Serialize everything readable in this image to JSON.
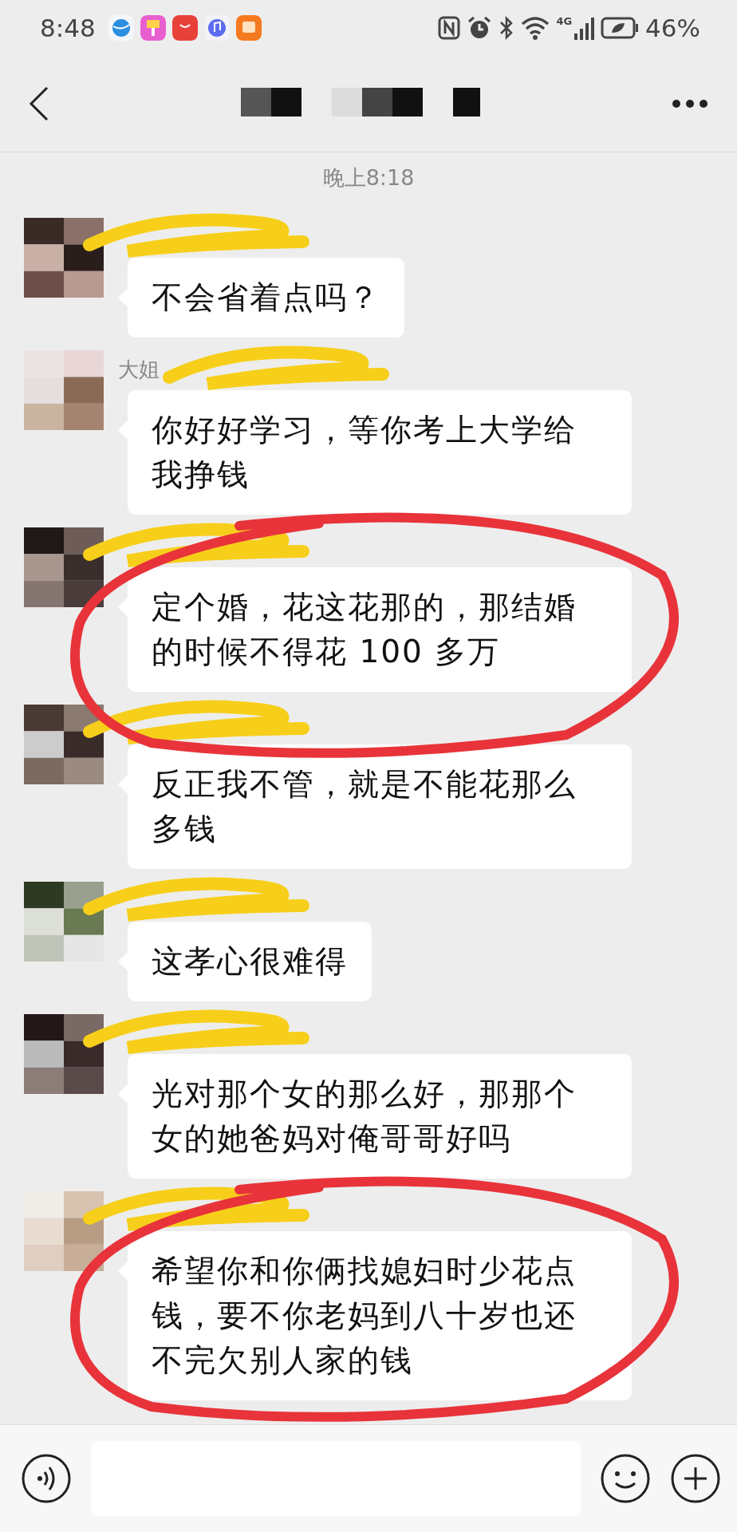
{
  "status_bar": {
    "time": "8:48",
    "network": "4G",
    "battery": "46%"
  },
  "chat": {
    "timestamp": "晚上8:18",
    "messages": [
      {
        "name_hidden": true,
        "text": "不会省着点吗？",
        "circled": false
      },
      {
        "sender": "大姐",
        "name_hidden": true,
        "text": "你好好学习，等你考上大学给我挣钱",
        "circled": false
      },
      {
        "name_hidden": true,
        "text": "定个婚，花这花那的，那结婚的时候不得花 100 多万",
        "circled": true
      },
      {
        "name_hidden": true,
        "text": "反正我不管，就是不能花那么多钱",
        "circled": false
      },
      {
        "name_hidden": true,
        "text": "这孝心很难得",
        "circled": false
      },
      {
        "name_hidden": true,
        "text": "光对那个女的那么好，那那个女的她爸妈对俺哥哥好吗",
        "circled": false
      },
      {
        "name_hidden": true,
        "text": "希望你和你俩找媳妇时少花点钱，要不你老妈到八十岁也还不完欠别人家的钱",
        "circled": true
      }
    ]
  }
}
